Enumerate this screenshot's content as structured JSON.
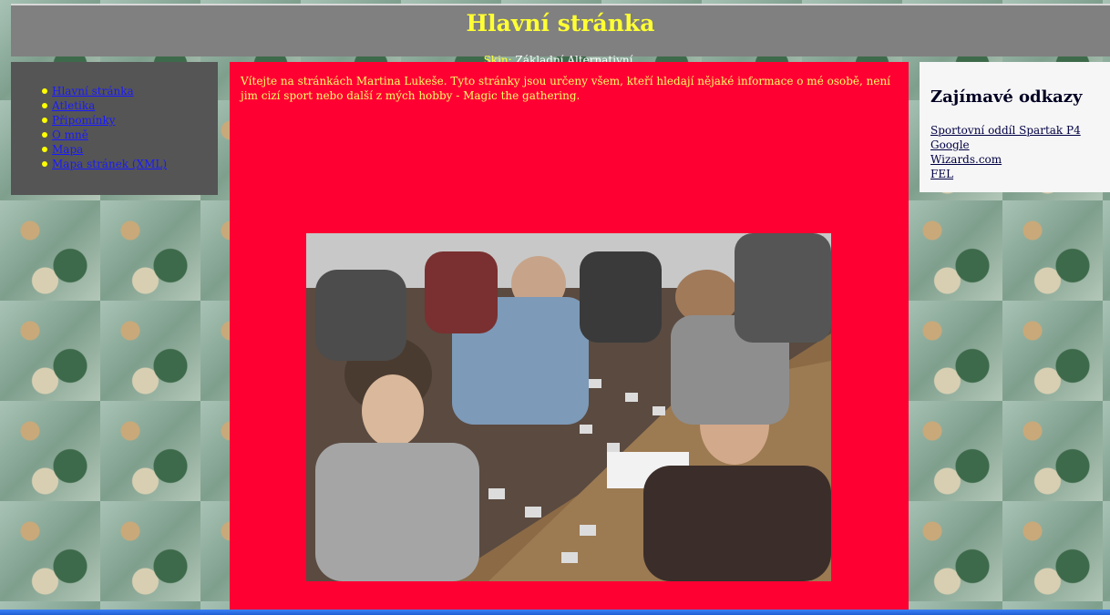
{
  "page": {
    "title": "Hlavní stránka",
    "skin_label": "Skin:",
    "skin_options": [
      "Základní",
      "Alternativní"
    ]
  },
  "nav": {
    "items": [
      "Hlavní stránka",
      "Atletika",
      "Připomínky",
      "O mně",
      "Mapa",
      "Mapa stránek (XML)"
    ]
  },
  "main": {
    "intro": "Vítejte na stránkách Martina Lukeše. Tyto stránky jsou určeny všem, kteří hledají nějaké informace o mé osobě, není jim cizí sport nebo další z mých hobby - Magic the gathering."
  },
  "links": {
    "heading": "Zajímavé odkazy",
    "items": [
      "Sportovní oddíl Spartak P4",
      "Google",
      "Wizards.com",
      "FEL"
    ]
  },
  "colors": {
    "header_bg": "#808080",
    "title": "#ffff33",
    "content_bg": "#ff0033",
    "nav_bg": "#555555",
    "links_bg": "#f6f6f6"
  }
}
